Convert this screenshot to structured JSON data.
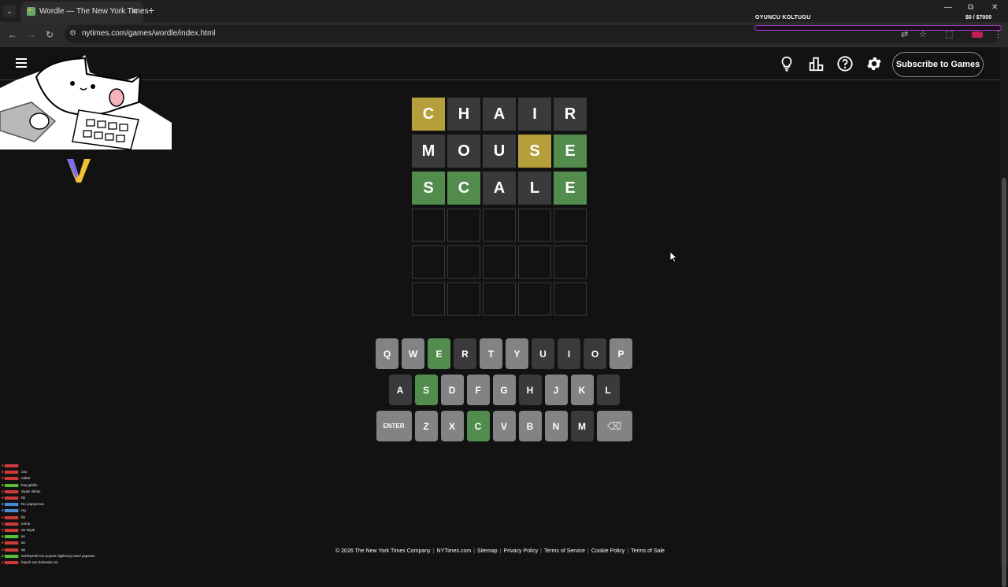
{
  "browser": {
    "tab_list_icon": "chevron-down-icon",
    "tab_title": "Wordle — The New York Times",
    "tab_close": "✕",
    "new_tab": "+",
    "url": "nytimes.com/games/wordle/index.html",
    "overlay_title": "OYUNCU KOLTUGU",
    "overlay_count": "$0 / $7000",
    "window_controls": [
      "—",
      "⧉",
      "✕"
    ]
  },
  "header": {
    "menu_icon": "hamburger-menu-icon",
    "icons": [
      "hint-lightbulb-icon",
      "stats-icon",
      "help-icon",
      "settings-gear-icon"
    ],
    "subscribe_label": "Subscribe to Games"
  },
  "colors": {
    "correct": "#538d4e",
    "present": "#b59f3b",
    "absent": "#3a3a3c",
    "unused_key": "#818384",
    "background": "#121213"
  },
  "board": {
    "rows": [
      [
        {
          "letter": "C",
          "state": "present"
        },
        {
          "letter": "H",
          "state": "absent"
        },
        {
          "letter": "A",
          "state": "absent"
        },
        {
          "letter": "I",
          "state": "absent"
        },
        {
          "letter": "R",
          "state": "absent"
        }
      ],
      [
        {
          "letter": "M",
          "state": "absent"
        },
        {
          "letter": "O",
          "state": "absent"
        },
        {
          "letter": "U",
          "state": "absent"
        },
        {
          "letter": "S",
          "state": "present"
        },
        {
          "letter": "E",
          "state": "correct"
        }
      ],
      [
        {
          "letter": "S",
          "state": "correct"
        },
        {
          "letter": "C",
          "state": "correct"
        },
        {
          "letter": "A",
          "state": "absent"
        },
        {
          "letter": "L",
          "state": "absent"
        },
        {
          "letter": "E",
          "state": "correct"
        }
      ],
      [
        {
          "letter": "",
          "state": "empty"
        },
        {
          "letter": "",
          "state": "empty"
        },
        {
          "letter": "",
          "state": "empty"
        },
        {
          "letter": "",
          "state": "empty"
        },
        {
          "letter": "",
          "state": "empty"
        }
      ],
      [
        {
          "letter": "",
          "state": "empty"
        },
        {
          "letter": "",
          "state": "empty"
        },
        {
          "letter": "",
          "state": "empty"
        },
        {
          "letter": "",
          "state": "empty"
        },
        {
          "letter": "",
          "state": "empty"
        }
      ],
      [
        {
          "letter": "",
          "state": "empty"
        },
        {
          "letter": "",
          "state": "empty"
        },
        {
          "letter": "",
          "state": "empty"
        },
        {
          "letter": "",
          "state": "empty"
        },
        {
          "letter": "",
          "state": "empty"
        }
      ]
    ]
  },
  "keyboard": {
    "rows": [
      [
        {
          "label": "Q",
          "state": "unused"
        },
        {
          "label": "W",
          "state": "unused"
        },
        {
          "label": "E",
          "state": "correct"
        },
        {
          "label": "R",
          "state": "absent"
        },
        {
          "label": "T",
          "state": "unused"
        },
        {
          "label": "Y",
          "state": "unused"
        },
        {
          "label": "U",
          "state": "absent"
        },
        {
          "label": "I",
          "state": "absent"
        },
        {
          "label": "O",
          "state": "absent"
        },
        {
          "label": "P",
          "state": "unused"
        }
      ],
      [
        {
          "label": "A",
          "state": "absent"
        },
        {
          "label": "S",
          "state": "correct"
        },
        {
          "label": "D",
          "state": "unused"
        },
        {
          "label": "F",
          "state": "unused"
        },
        {
          "label": "G",
          "state": "unused"
        },
        {
          "label": "H",
          "state": "absent"
        },
        {
          "label": "J",
          "state": "unused"
        },
        {
          "label": "K",
          "state": "unused"
        },
        {
          "label": "L",
          "state": "absent"
        }
      ],
      [
        {
          "label": "ENTER",
          "state": "unused",
          "wide": true
        },
        {
          "label": "Z",
          "state": "unused"
        },
        {
          "label": "X",
          "state": "unused"
        },
        {
          "label": "C",
          "state": "correct"
        },
        {
          "label": "V",
          "state": "unused"
        },
        {
          "label": "B",
          "state": "unused"
        },
        {
          "label": "N",
          "state": "unused"
        },
        {
          "label": "M",
          "state": "absent"
        },
        {
          "label": "⌫",
          "state": "unused",
          "wide": true
        }
      ]
    ]
  },
  "footer": {
    "links": [
      "© 2026 The New York Times Company",
      "NYTimes.com",
      "Sitemap",
      "Privacy Policy",
      "Terms of Service",
      "Cookie Policy",
      "Terms of Sale"
    ]
  },
  "stream_overlay": {
    "chat": [
      {
        "user": "",
        "text": "",
        "color": "red"
      },
      {
        "user": "",
        "text": "ooo",
        "color": "red"
      },
      {
        "user": "",
        "text": "naber",
        "color": "red"
      },
      {
        "user": "",
        "text": "hoş geldin",
        "color": "green"
      },
      {
        "user": "",
        "text": "siyasi olmaz",
        "color": "red"
      },
      {
        "user": "",
        "text": "hb",
        "color": "red"
      },
      {
        "user": "",
        "text": "No yapıyorsun",
        "color": "blue"
      },
      {
        "user": "",
        "text": "Hg",
        "color": "blue"
      },
      {
        "user": "",
        "text": "hb",
        "color": "red"
      },
      {
        "user": "",
        "text": "nomo",
        "color": "red"
      },
      {
        "user": "",
        "text": "Se kaydı",
        "color": "red"
      },
      {
        "user": "",
        "text": "as",
        "color": "green"
      },
      {
        "user": "",
        "text": "as",
        "color": "red"
      },
      {
        "user": "",
        "text": "ap",
        "color": "red"
      },
      {
        "user": "",
        "text": "sözleşmeli son poyraz ingilizceyi nasıl yapacaz",
        "color": "green"
      },
      {
        "user": "",
        "text": "hayırlı ses dokundu mu",
        "color": "red"
      }
    ]
  }
}
